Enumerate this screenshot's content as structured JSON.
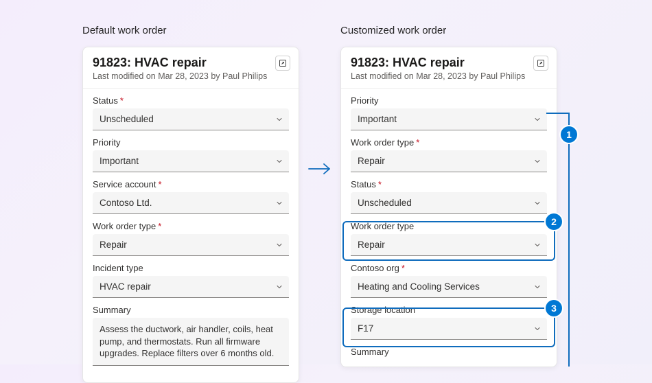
{
  "accent": "#0078d4",
  "left": {
    "heading": "Default work order",
    "header": {
      "title": "91823: HVAC repair",
      "subtitle": "Last modified on Mar 28, 2023 by Paul Philips"
    },
    "fields": [
      {
        "label": "Status",
        "required": true,
        "value": "Unscheduled"
      },
      {
        "label": "Priority",
        "required": false,
        "value": "Important"
      },
      {
        "label": "Service account",
        "required": true,
        "value": "Contoso Ltd."
      },
      {
        "label": "Work order type",
        "required": true,
        "value": "Repair"
      },
      {
        "label": "Incident type",
        "required": false,
        "value": "HVAC repair"
      }
    ],
    "summary": {
      "label": "Summary",
      "text": "Assess the ductwork, air handler, coils, heat pump, and thermostats. Run all firmware upgrades. Replace filters over 6 months old."
    }
  },
  "right": {
    "heading": "Customized work order",
    "header": {
      "title": "91823: HVAC repair",
      "subtitle": "Last modified on Mar 28, 2023 by Paul Philips"
    },
    "fields": [
      {
        "label": "Priority",
        "required": false,
        "value": "Important"
      },
      {
        "label": "Work order type",
        "required": true,
        "value": "Repair"
      },
      {
        "label": "Status",
        "required": true,
        "value": "Unscheduled"
      },
      {
        "label": "Work order type",
        "required": false,
        "value": "Repair"
      },
      {
        "label": "Contoso org",
        "required": true,
        "value": "Heating and Cooling Services"
      },
      {
        "label": "Storage location",
        "required": false,
        "value": "F17"
      }
    ],
    "summary": {
      "label": "Summary"
    }
  },
  "callouts": {
    "b1": "1",
    "b2": "2",
    "b3": "3"
  }
}
